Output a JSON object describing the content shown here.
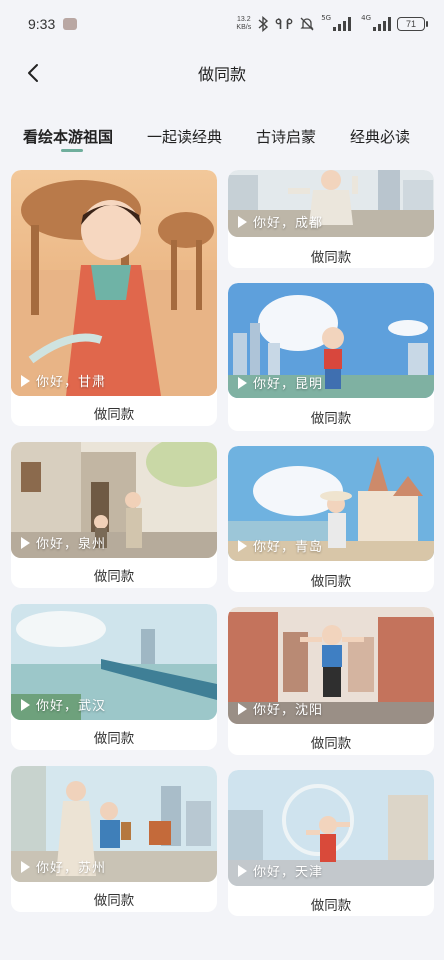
{
  "status_bar": {
    "time": "9:33",
    "net_speed_value": "13.2",
    "net_speed_unit": "KB/s",
    "signal_1_label": "5G",
    "signal_2_label": "4G",
    "battery": "71",
    "icons": [
      "bluetooth-icon",
      "earbuds-icon",
      "mute-icon",
      "signal-icon",
      "battery-icon"
    ]
  },
  "nav": {
    "title": "做同款",
    "back_icon": "chevron-left-icon"
  },
  "tabs": [
    {
      "label": "看绘本游祖国",
      "active": true
    },
    {
      "label": "一起读经典",
      "active": false
    },
    {
      "label": "古诗启蒙",
      "active": false
    },
    {
      "label": "经典必读",
      "active": false
    }
  ],
  "accent_color": "#6fae9c",
  "cards": [
    {
      "caption": "你好，甘肃",
      "action": "做同款"
    },
    {
      "caption": "你好，成都",
      "action": "做同款"
    },
    {
      "caption": "你好，昆明",
      "action": "做同款"
    },
    {
      "caption": "你好，泉州",
      "action": "做同款"
    },
    {
      "caption": "你好，青岛",
      "action": "做同款"
    },
    {
      "caption": "你好，武汉",
      "action": "做同款"
    },
    {
      "caption": "你好，沈阳",
      "action": "做同款"
    },
    {
      "caption": "你好，苏州",
      "action": "做同款"
    },
    {
      "caption": "你好，天津",
      "action": "做同款"
    }
  ]
}
